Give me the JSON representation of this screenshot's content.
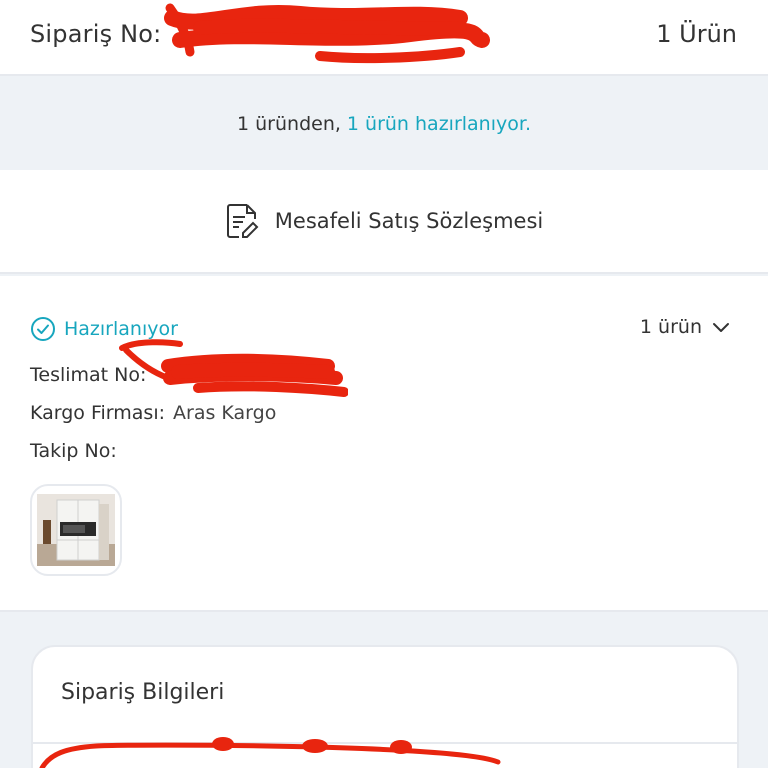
{
  "header": {
    "order_label": "Sipariş No:",
    "item_count": "1 Ürün"
  },
  "summary": {
    "text": "1 üründen,",
    "highlight": "1 ürün hazırlanıyor."
  },
  "contract": {
    "label": "Mesafeli Satış Sözleşmesi",
    "icon": "document-edit-icon"
  },
  "package": {
    "status": "Hazırlanıyor",
    "status_icon": "check-circle-icon",
    "item_toggle": "1 ürün",
    "delivery_label": "Teslimat No:",
    "cargo_label": "Kargo Firması:",
    "cargo_value": "Aras Kargo",
    "tracking_label": "Takip No:"
  },
  "order_info": {
    "title": "Sipariş Bilgileri"
  },
  "colors": {
    "accent": "#17a6be",
    "redaction": "#e8250f",
    "background": "#eef2f6"
  }
}
